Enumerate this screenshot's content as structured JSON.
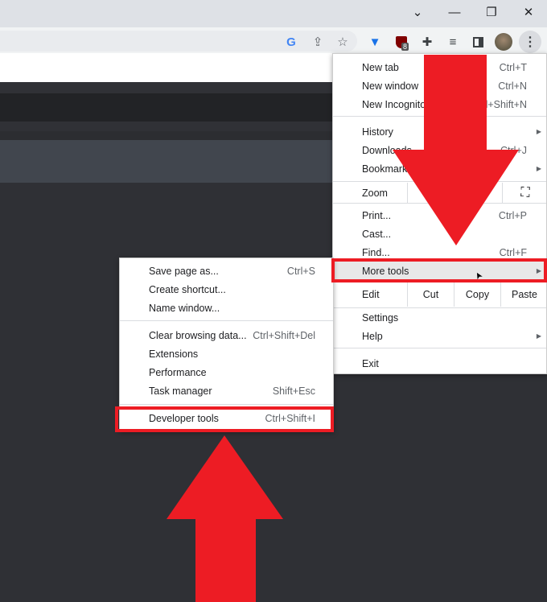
{
  "window": {
    "tabs_dropdown": "⌄",
    "minimize": "—",
    "restore": "❐",
    "close": "✕"
  },
  "toolbar": {
    "icons": [
      "google-icon",
      "share-icon",
      "star-icon",
      "diamond-extension-icon",
      "ublock-icon",
      "puzzle-extensions-icon",
      "media-queue-icon",
      "side-panel-icon",
      "profile-avatar",
      "kebab-menu-icon"
    ],
    "ublock_badge": "8"
  },
  "main_menu": {
    "items": [
      {
        "label": "New tab",
        "shortcut": "Ctrl+T"
      },
      {
        "label": "New window",
        "shortcut": "Ctrl+N"
      },
      {
        "label": "New Incognito window",
        "shortcut": "Ctrl+Shift+N"
      },
      {
        "label": "History",
        "submenu": true
      },
      {
        "label": "Downloads",
        "shortcut": "Ctrl+J"
      },
      {
        "label": "Bookmarks",
        "submenu": true
      },
      {
        "label": "Zoom",
        "fullscreen": true
      },
      {
        "label": "Print...",
        "shortcut": "Ctrl+P"
      },
      {
        "label": "Cast..."
      },
      {
        "label": "Find...",
        "shortcut": "Ctrl+F"
      },
      {
        "label": "More tools",
        "submenu": true,
        "highlighted": true
      },
      {
        "label": "Edit",
        "actions": [
          "Cut",
          "Copy",
          "Paste"
        ]
      },
      {
        "label": "Settings"
      },
      {
        "label": "Help",
        "submenu": true
      },
      {
        "label": "Exit"
      }
    ]
  },
  "more_tools_menu": {
    "items": [
      {
        "label": "Save page as...",
        "shortcut": "Ctrl+S"
      },
      {
        "label": "Create shortcut..."
      },
      {
        "label": "Name window..."
      },
      {
        "label": "Clear browsing data...",
        "shortcut": "Ctrl+Shift+Del"
      },
      {
        "label": "Extensions"
      },
      {
        "label": "Performance"
      },
      {
        "label": "Task manager",
        "shortcut": "Shift+Esc"
      },
      {
        "label": "Developer tools",
        "shortcut": "Ctrl+Shift+I"
      }
    ]
  },
  "annotations": {
    "color": "#ed1c24"
  }
}
